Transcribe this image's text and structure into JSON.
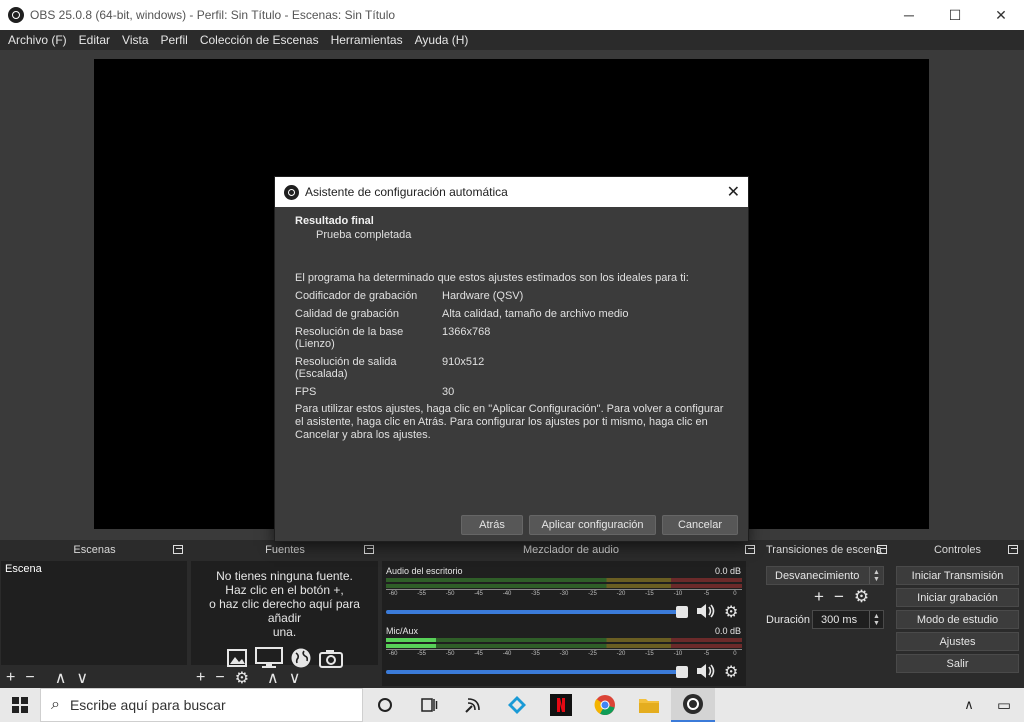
{
  "window": {
    "title": "OBS 25.0.8 (64-bit, windows) - Perfil: Sin Título - Escenas: Sin Título",
    "min": "─",
    "max": "☐",
    "close": "✕"
  },
  "menu": [
    "Archivo (F)",
    "Editar",
    "Vista",
    "Perfil",
    "Colección de Escenas",
    "Herramientas",
    "Ayuda (H)"
  ],
  "dialog": {
    "title": "Asistente de configuración automática",
    "close": "✕",
    "heading": "Resultado final",
    "subheading": "Prueba completada",
    "intro": "El programa ha determinado que estos ajustes estimados son los ideales para ti:",
    "settings": [
      {
        "label": "Codificador de grabación",
        "value": "Hardware (QSV)"
      },
      {
        "label": "Calidad de grabación",
        "value": "Alta calidad, tamaño de archivo medio"
      },
      {
        "label": "Resolución de la base (Lienzo)",
        "value": "1366x768"
      },
      {
        "label": "Resolución de salida (Escalada)",
        "value": "910x512"
      },
      {
        "label": "FPS",
        "value": "30"
      }
    ],
    "note": "Para utilizar estos ajustes, haga clic en \"Aplicar Configuración\". Para volver a configurar el asistente, haga clic en Atrás. Para configurar los ajustes por ti mismo, haga clic en Cancelar y abra los ajustes.",
    "buttons": {
      "back": "Atrás",
      "apply": "Aplicar configuración",
      "cancel": "Cancelar"
    }
  },
  "docks": {
    "scenes": {
      "title": "Escenas",
      "items": [
        "Escena"
      ]
    },
    "sources": {
      "title": "Fuentes",
      "empty_lines": [
        "No tienes ninguna fuente.",
        "Haz clic en el botón +,",
        "o haz clic derecho aquí para añadir",
        "una."
      ]
    },
    "mixer": {
      "title": "Mezclador de audio",
      "tick_labels": [
        "-60",
        "-55",
        "-50",
        "-45",
        "-40",
        "-35",
        "-30",
        "-25",
        "-20",
        "-15",
        "-10",
        "-5",
        "0"
      ],
      "channels": [
        {
          "name": "Audio del escritorio",
          "db": "0.0 dB",
          "level": 0.0,
          "volume": 1.0
        },
        {
          "name": "Mic/Aux",
          "db": "0.0 dB",
          "level": 0.14,
          "volume": 1.0
        }
      ]
    },
    "transitions": {
      "title": "Transiciones de escena",
      "selected": "Desvanecimiento",
      "duration_label": "Duración",
      "duration_value": "300 ms"
    },
    "controls": {
      "title": "Controles",
      "buttons": [
        "Iniciar Transmisión",
        "Iniciar grabación",
        "Modo de estudio",
        "Ajustes",
        "Salir"
      ]
    }
  },
  "toolbar_glyphs": {
    "add": "+",
    "remove": "−",
    "up": "∧",
    "down": "∨",
    "gear": "⚙"
  },
  "taskbar": {
    "search_placeholder": "Escribe aquí para buscar",
    "search_glyph": "⌕",
    "apps": [
      "task-view",
      "timeline",
      "network",
      "kodi",
      "netflix",
      "chrome",
      "file-explorer",
      "obs"
    ],
    "tray_chevron": "∧",
    "notifications": "▭"
  },
  "colors": {
    "accent": "#3b7bd9",
    "meter_green": "#58d058",
    "netflix_red": "#e50914"
  }
}
